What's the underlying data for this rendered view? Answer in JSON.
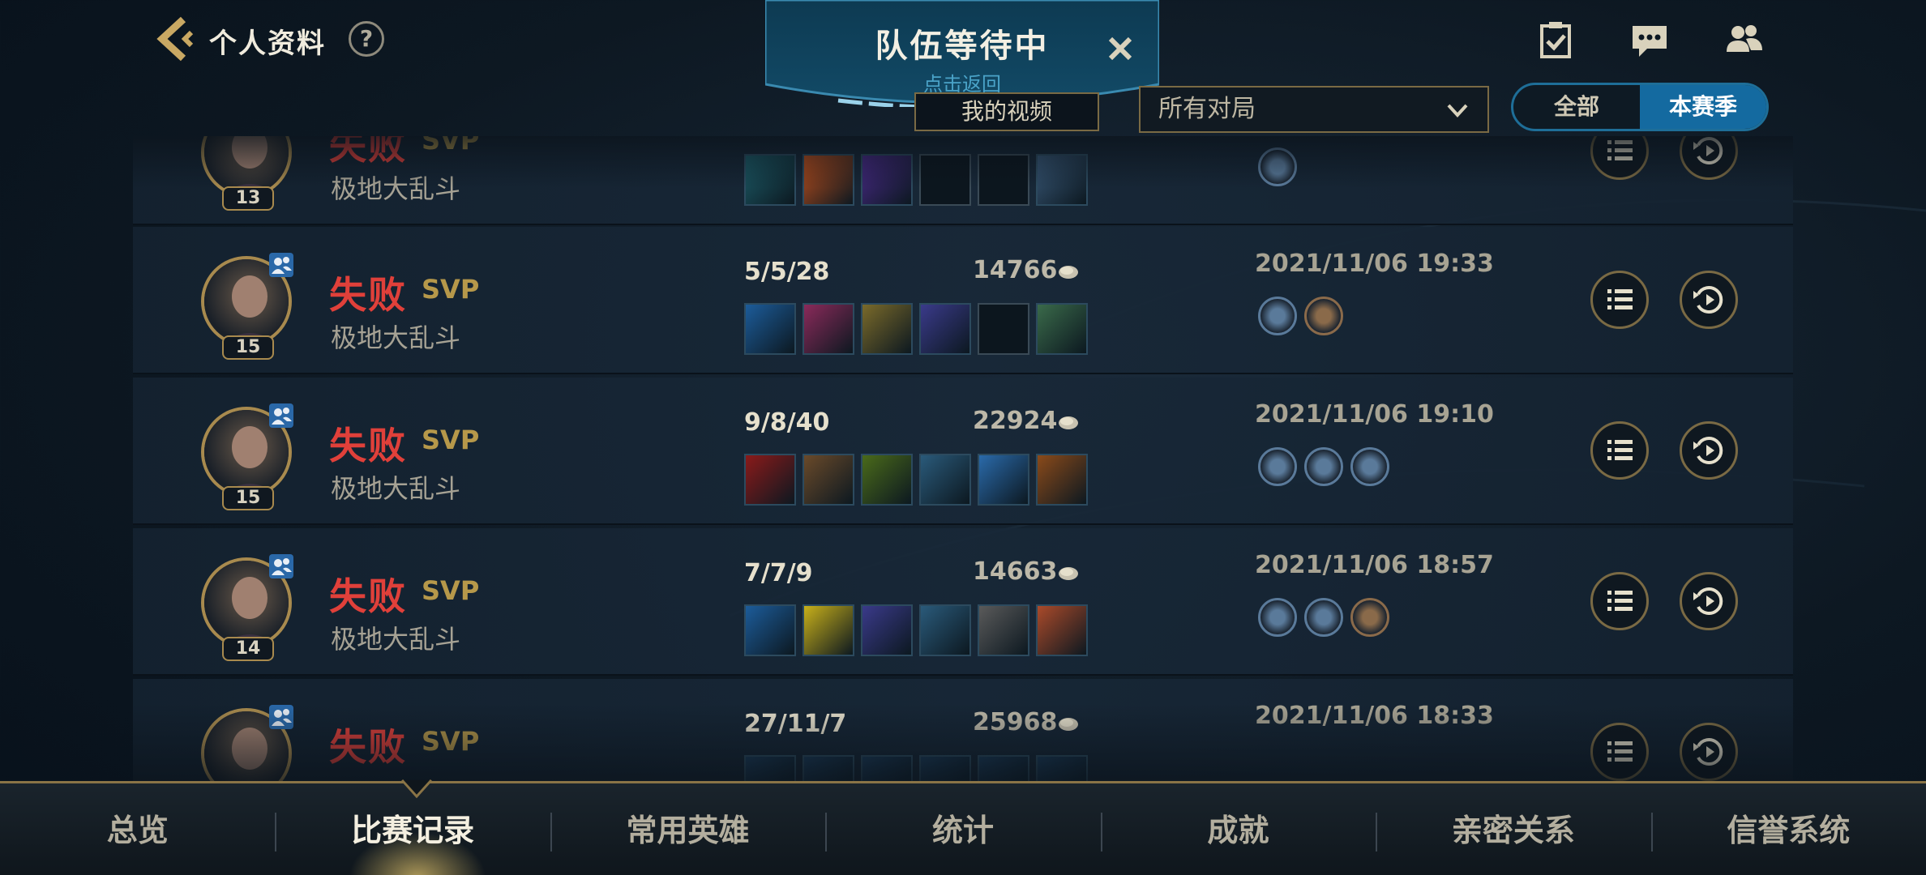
{
  "header": {
    "title": "个人资料",
    "help_icon": "?"
  },
  "queue_banner": {
    "title": "队伍等待中",
    "subtitle": "点击返回"
  },
  "filters": {
    "video_button": "我的视频",
    "match_filter": "所有对局",
    "season_all": "全部",
    "season_current": "本赛季"
  },
  "matches": [
    {
      "result": "失败",
      "svp": "SVP",
      "mode": "极地大乱斗",
      "level": "13",
      "kda": "",
      "gold": "",
      "datetime": "",
      "items": [
        "#1d5e6a",
        "#c0501c",
        "#4a2a8a",
        "",
        "",
        "#3a5a7a"
      ],
      "medals": [
        "#5a7a9a"
      ]
    },
    {
      "result": "失败",
      "svp": "SVP",
      "mode": "极地大乱斗",
      "level": "15",
      "kda": "5/5/28",
      "gold": "14766",
      "datetime": "2021/11/06 19:33",
      "items": [
        "#1c5c9a",
        "#8a2a5a",
        "#7a6a2a",
        "#3a3a8a",
        "",
        "#3a6a4a"
      ],
      "medals": [
        "#5a7a9a",
        "#8a6a4a"
      ]
    },
    {
      "result": "失败",
      "svp": "SVP",
      "mode": "极地大乱斗",
      "level": "15",
      "kda": "9/8/40",
      "gold": "22924",
      "datetime": "2021/11/06 19:10",
      "items": [
        "#8a1a1a",
        "#6a4a2a",
        "#4a6a1a",
        "#2a5a7a",
        "#2a6aaa",
        "#8a4a1a"
      ],
      "medals": [
        "#5a7a9a",
        "#5a7a9a",
        "#5a7a9a"
      ]
    },
    {
      "result": "失败",
      "svp": "SVP",
      "mode": "极地大乱斗",
      "level": "14",
      "kda": "7/7/9",
      "gold": "14663",
      "datetime": "2021/11/06 18:57",
      "items": [
        "#1c5c9a",
        "#c8b01a",
        "#3a3a8a",
        "#2a5a7a",
        "#5a5a5a",
        "#aa4a2a"
      ],
      "medals": [
        "#5a7a9a",
        "#5a7a9a",
        "#8a6a4a"
      ]
    },
    {
      "result": "失败",
      "svp": "SVP",
      "mode": "",
      "level": "",
      "kda": "27/11/7",
      "gold": "25968",
      "datetime": "2021/11/06 18:33",
      "items": [
        "#1c3c5a",
        "#1c3c5a",
        "#1c3c5a",
        "#1c3c5a",
        "#1c3c5a",
        "#1c3c5a"
      ],
      "medals": []
    }
  ],
  "nav": {
    "tabs": [
      "总览",
      "比赛记录",
      "常用英雄",
      "统计",
      "成就",
      "亲密关系",
      "信誉系统"
    ],
    "active": "比赛记录"
  },
  "colors": {
    "loss_red": "#e0403a",
    "gold_accent": "#a88a4e",
    "season_active": "#146aa0"
  },
  "icons": [
    "back-chevron-icon",
    "help-icon",
    "task-checklist-icon",
    "chat-icon",
    "friends-icon",
    "close-icon",
    "chevron-down-icon",
    "coin-icon",
    "party-icon",
    "details-list-icon",
    "replay-icon"
  ]
}
